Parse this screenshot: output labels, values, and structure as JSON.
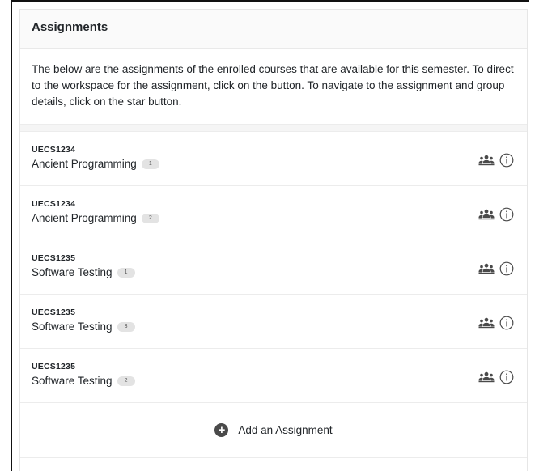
{
  "header": {
    "title": "Assignments"
  },
  "intro": {
    "text": "The below are the assignments of the enrolled courses that are available for this semester. To direct to the workspace for the assignment, click on the button. To navigate to the assignment and group details, click on the star button."
  },
  "assignments": [
    {
      "code": "UECS1234",
      "name": "Ancient Programming",
      "badge": "1",
      "group_icon": "group-icon",
      "info_icon": "info-icon"
    },
    {
      "code": "UECS1234",
      "name": "Ancient Programming",
      "badge": "2",
      "group_icon": "group-icon",
      "info_icon": "info-icon"
    },
    {
      "code": "UECS1235",
      "name": "Software Testing",
      "badge": "1",
      "group_icon": "group-icon",
      "info_icon": "info-icon"
    },
    {
      "code": "UECS1235",
      "name": "Software Testing",
      "badge": "3",
      "group_icon": "group-icon",
      "info_icon": "info-icon"
    },
    {
      "code": "UECS1235",
      "name": "Software Testing",
      "badge": "2",
      "group_icon": "group-icon",
      "info_icon": "info-icon"
    }
  ],
  "add": {
    "label": "Add an Assignment",
    "icon": "plus-circle-icon"
  },
  "colors": {
    "icon": "#4a4a4a",
    "badge_bg": "#e3e3e3",
    "header_bg": "#fafafa"
  }
}
